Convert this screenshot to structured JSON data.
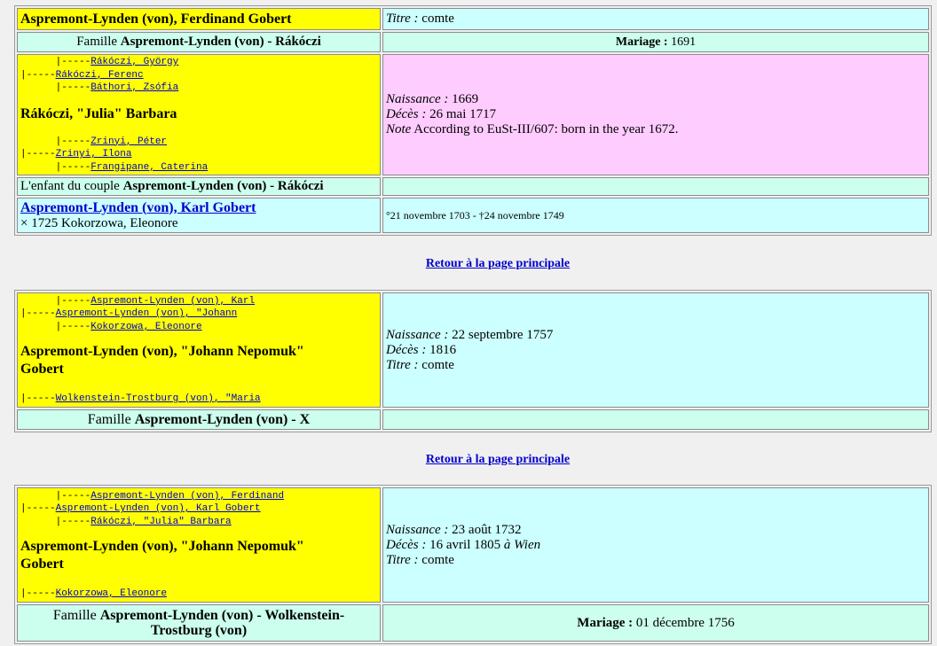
{
  "block1": {
    "person_name": "Aspremont-Lynden (von), Ferdinand Gobert",
    "titre_label": "Titre :",
    "titre_value": "comte",
    "famille_prefix": "Famille",
    "famille_name": "Aspremont-Lynden (von) - Rákóczi",
    "mariage_label": "Mariage :",
    "mariage_value": "1691",
    "tree": {
      "l1_prefix": "      |-----",
      "l1_link": "Rákóczi, György",
      "l2_prefix": "|-----",
      "l2_link": "Rákóczi, Ferenc",
      "l3_prefix": "      |-----",
      "l3_link": "Báthori, Zsófia",
      "name": "Rákóczi, \"Julia\" Barbara",
      "l4_prefix": "      |-----",
      "l4_link": "Zrinyi, Péter",
      "l5_prefix": "|-----",
      "l5_link": "Zrinyi, Ilona",
      "l6_prefix": "      |-----",
      "l6_link": "Frangipane, Caterina"
    },
    "spouse_info": {
      "naissance_label": "Naissance :",
      "naissance_value": "1669",
      "deces_label": "Décès :",
      "deces_value": "26 mai 1717",
      "note_label": "Note",
      "note_value": "According to EuSt-III/607: born in the year 1672."
    },
    "enfant_prefix": "L'enfant du couple",
    "enfant_couple": "Aspremont-Lynden (von) - Rákóczi",
    "child_name": "Aspremont-Lynden (von), Karl Gobert",
    "child_marriage": "× 1725 Kokorzowa, Eleonore",
    "child_dates": "°21 novembre 1703 - †24 novembre 1749"
  },
  "return_link": "Retour à la page principale",
  "block2": {
    "tree": {
      "l1_prefix": "      |-----",
      "l1_link": "Aspremont-Lynden (von), Karl",
      "l2_prefix": "|-----",
      "l2_link": "Aspremont-Lynden (von), \"Johann",
      "l3_prefix": "      |-----",
      "l3_link": "Kokorzowa, Eleonore",
      "name": "Aspremont-Lynden (von), \"Johann Nepomuk\" Gobert",
      "l4_prefix": "|-----",
      "l4_link": "Wolkenstein-Trostburg (von), \"Maria"
    },
    "naissance_label": "Naissance :",
    "naissance_value": "22 septembre 1757",
    "deces_label": "Décès :",
    "deces_value": "1816",
    "titre_label": "Titre :",
    "titre_value": "comte",
    "famille_prefix": "Famille",
    "famille_name": "Aspremont-Lynden (von) - X"
  },
  "block3": {
    "tree": {
      "l1_prefix": "      |-----",
      "l1_link": "Aspremont-Lynden (von), Ferdinand",
      "l2_prefix": "|-----",
      "l2_link": "Aspremont-Lynden (von), Karl Gobert",
      "l3_prefix": "      |-----",
      "l3_link": "Rákóczi, \"Julia\" Barbara",
      "name": "Aspremont-Lynden (von), \"Johann Nepomuk\" Gobert",
      "l4_prefix": "|-----",
      "l4_link": "Kokorzowa, Eleonore"
    },
    "naissance_label": "Naissance :",
    "naissance_value": "23 août 1732",
    "deces_label": "Décès :",
    "deces_value": "16 avril 1805",
    "deces_place_prep": "à",
    "deces_place": "Wien",
    "titre_label": "Titre :",
    "titre_value": "comte",
    "famille_prefix": "Famille",
    "famille_name": "Aspremont-Lynden (von) - Wolkenstein-Trostburg (von)",
    "mariage_label": "Mariage :",
    "mariage_value": "01 décembre 1756"
  },
  "colors": {
    "yellow": "#ffff00",
    "cyan": "#ccffff",
    "mint": "#ccffee",
    "pink": "#ffccff",
    "link": "#0000cc",
    "background": "#f0f0f0"
  }
}
